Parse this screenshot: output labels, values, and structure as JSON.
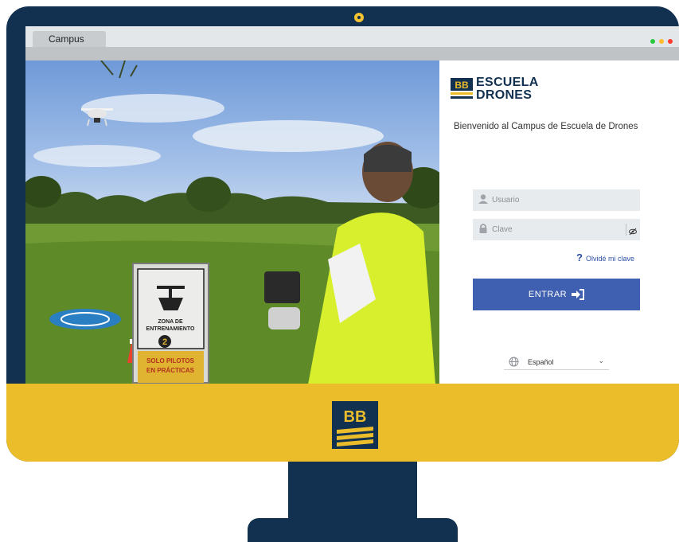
{
  "browser": {
    "tab_label": "Campus",
    "window_dots": [
      "#27c93f",
      "#ffbd2e",
      "#ff3b30"
    ]
  },
  "login": {
    "brand_line1": "ESCUELA",
    "brand_line2": "DRONES",
    "welcome": "Bienvenido al Campus de Escuela de Drones",
    "username_placeholder": "Usuario",
    "password_placeholder": "Clave",
    "forgot_label": "Olvidé mi clave",
    "enter_label": "ENTRAR",
    "language": "Español"
  },
  "photo": {
    "sign_line1": "ZONA DE",
    "sign_line2": "ENTRENAMIENTO",
    "sign_number": "2",
    "sign_footer1": "SOLO PILOTOS",
    "sign_footer2": "EN PRÁCTICAS"
  },
  "colors": {
    "monitor": "#12304f",
    "base": "#ebbd2a",
    "button": "#3f5fb0",
    "link": "#2c4fa6"
  }
}
